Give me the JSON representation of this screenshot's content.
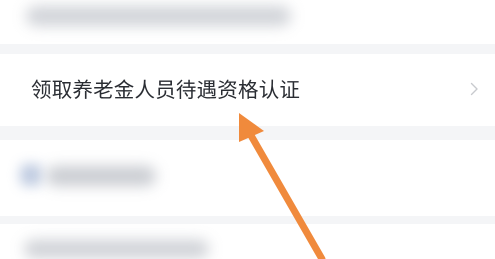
{
  "list": {
    "main_item": {
      "label": "领取养老金人员待遇资格认证",
      "chevron_icon": "chevron-right-icon"
    },
    "blurred_items": [
      "blurred-row-top",
      "blurred-row-mid",
      "blurred-row-bottom"
    ]
  },
  "annotation": {
    "arrow_icon": "pointer-arrow-icon",
    "color": "#f08a3c"
  },
  "colors": {
    "background": "#f4f5f7",
    "card": "#ffffff",
    "text": "#2a2d33",
    "chevron": "#c8cace"
  }
}
